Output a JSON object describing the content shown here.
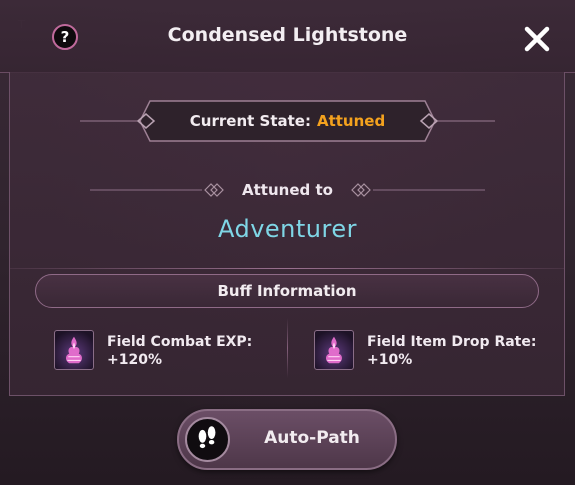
{
  "window": {
    "title": "Condensed Lightstone"
  },
  "header": {
    "help_icon": "question-icon",
    "help_glyph": "?",
    "close_icon": "close-x-icon"
  },
  "state": {
    "label": "Current State:",
    "value": "Attuned",
    "value_color": "#f4a21e"
  },
  "attunement": {
    "label": "Attuned to",
    "class_name": "Adventurer",
    "class_color": "#7fd6e6"
  },
  "buffs": {
    "header": "Buff Information",
    "items": [
      {
        "icon": "lightstone-buff-icon",
        "name": "Field Combat EXP:",
        "value": "+120%"
      },
      {
        "icon": "lightstone-buff-icon",
        "name": "Field Item Drop Rate:",
        "value": "+10%"
      }
    ]
  },
  "autopath": {
    "label": "Auto-Path",
    "icon": "footprints-icon"
  },
  "colors": {
    "accent_pink": "#c06a9c",
    "panel_border": "#6d5168"
  }
}
